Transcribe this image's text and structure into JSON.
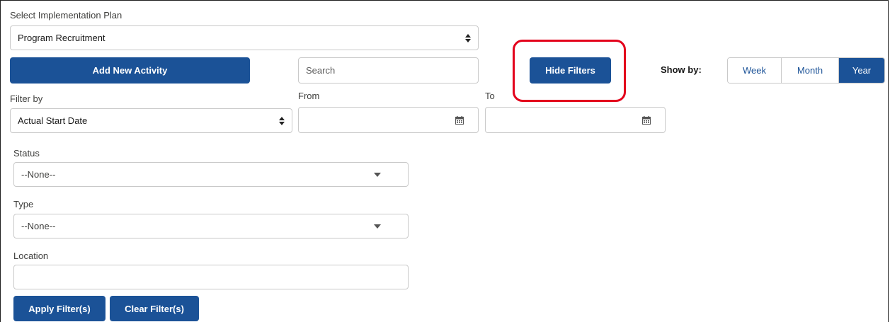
{
  "plan": {
    "label": "Select Implementation Plan",
    "value": "Program Recruitment"
  },
  "toolbar": {
    "add_activity": "Add New Activity",
    "search_placeholder": "Search",
    "hide_filters": "Hide Filters",
    "show_by_label": "Show by:",
    "show_by_options": [
      "Week",
      "Month",
      "Year"
    ],
    "show_by_selected": "Year"
  },
  "filters": {
    "filter_by_label": "Filter by",
    "filter_by_value": "Actual Start Date",
    "from_label": "From",
    "from_value": "",
    "to_label": "To",
    "to_value": "",
    "status_label": "Status",
    "status_value": "--None--",
    "type_label": "Type",
    "type_value": "--None--",
    "location_label": "Location",
    "location_value": "",
    "apply": "Apply Filter(s)",
    "clear": "Clear Filter(s)"
  },
  "colors": {
    "brand_blue": "#1b5297",
    "highlight_red": "#e3001b",
    "border_gray": "#c9c9c9"
  },
  "icons": {
    "select_arrows": "sort-arrows-icon",
    "dropdown": "chevron-down-icon",
    "calendar": "calendar-icon"
  }
}
